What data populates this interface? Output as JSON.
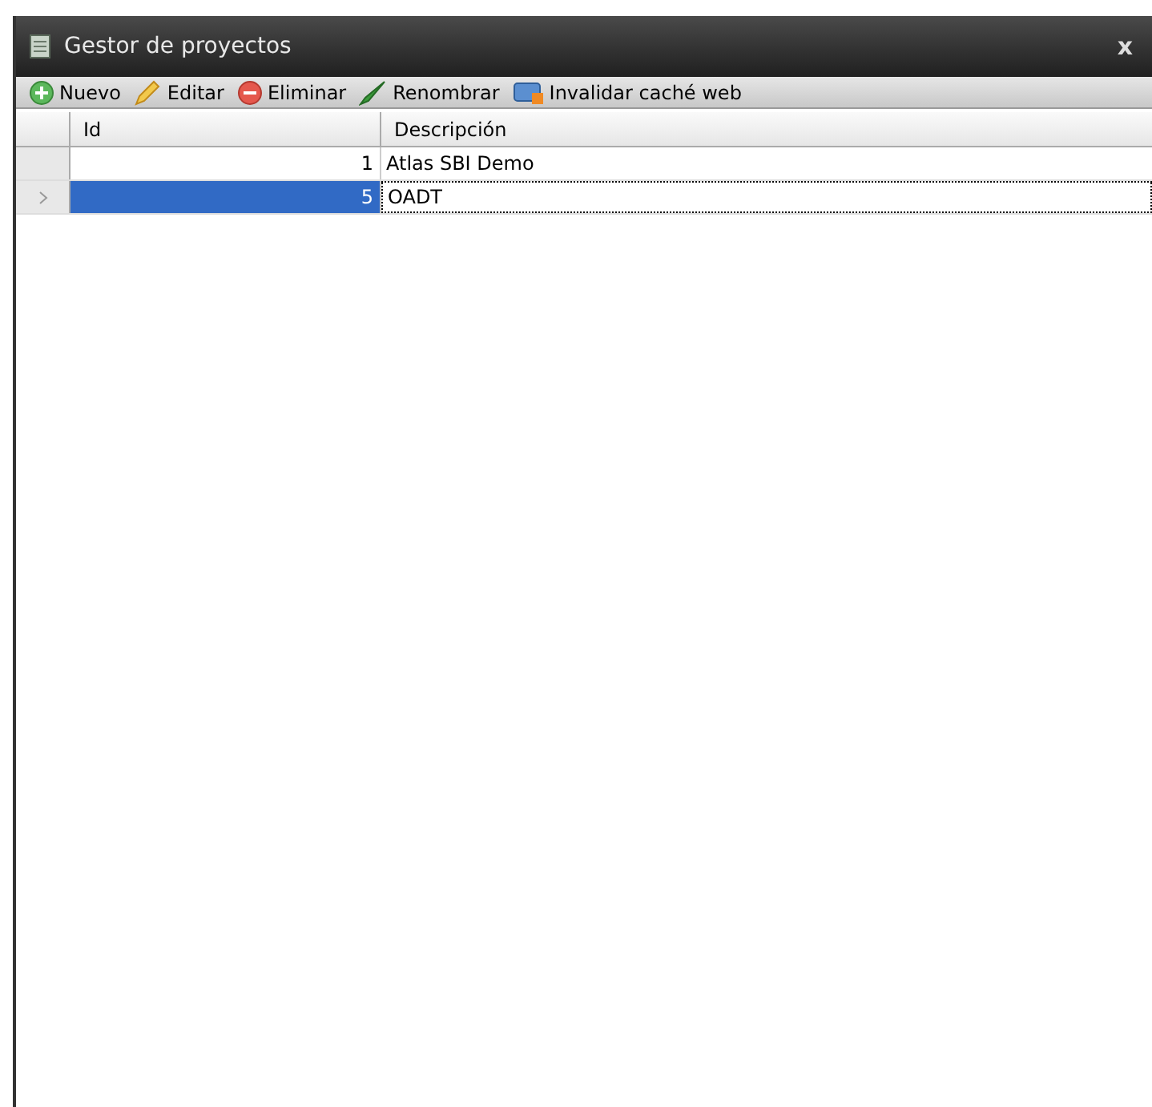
{
  "window": {
    "title": "Gestor de proyectos",
    "close": "x"
  },
  "toolbar": [
    {
      "kind": "add",
      "label": "Nuevo"
    },
    {
      "kind": "edit",
      "label": "Editar"
    },
    {
      "kind": "delete",
      "label": "Eliminar"
    },
    {
      "kind": "rename",
      "label": "Renombrar"
    },
    {
      "kind": "cache",
      "label": "Invalidar caché web"
    }
  ],
  "table": {
    "columns": [
      "Id",
      "Descripción"
    ],
    "rows": [
      {
        "cells": [
          "1",
          "Atlas SBI Demo"
        ],
        "selected": false
      },
      {
        "cells": [
          "5",
          "OADT"
        ],
        "selected": true
      }
    ]
  }
}
